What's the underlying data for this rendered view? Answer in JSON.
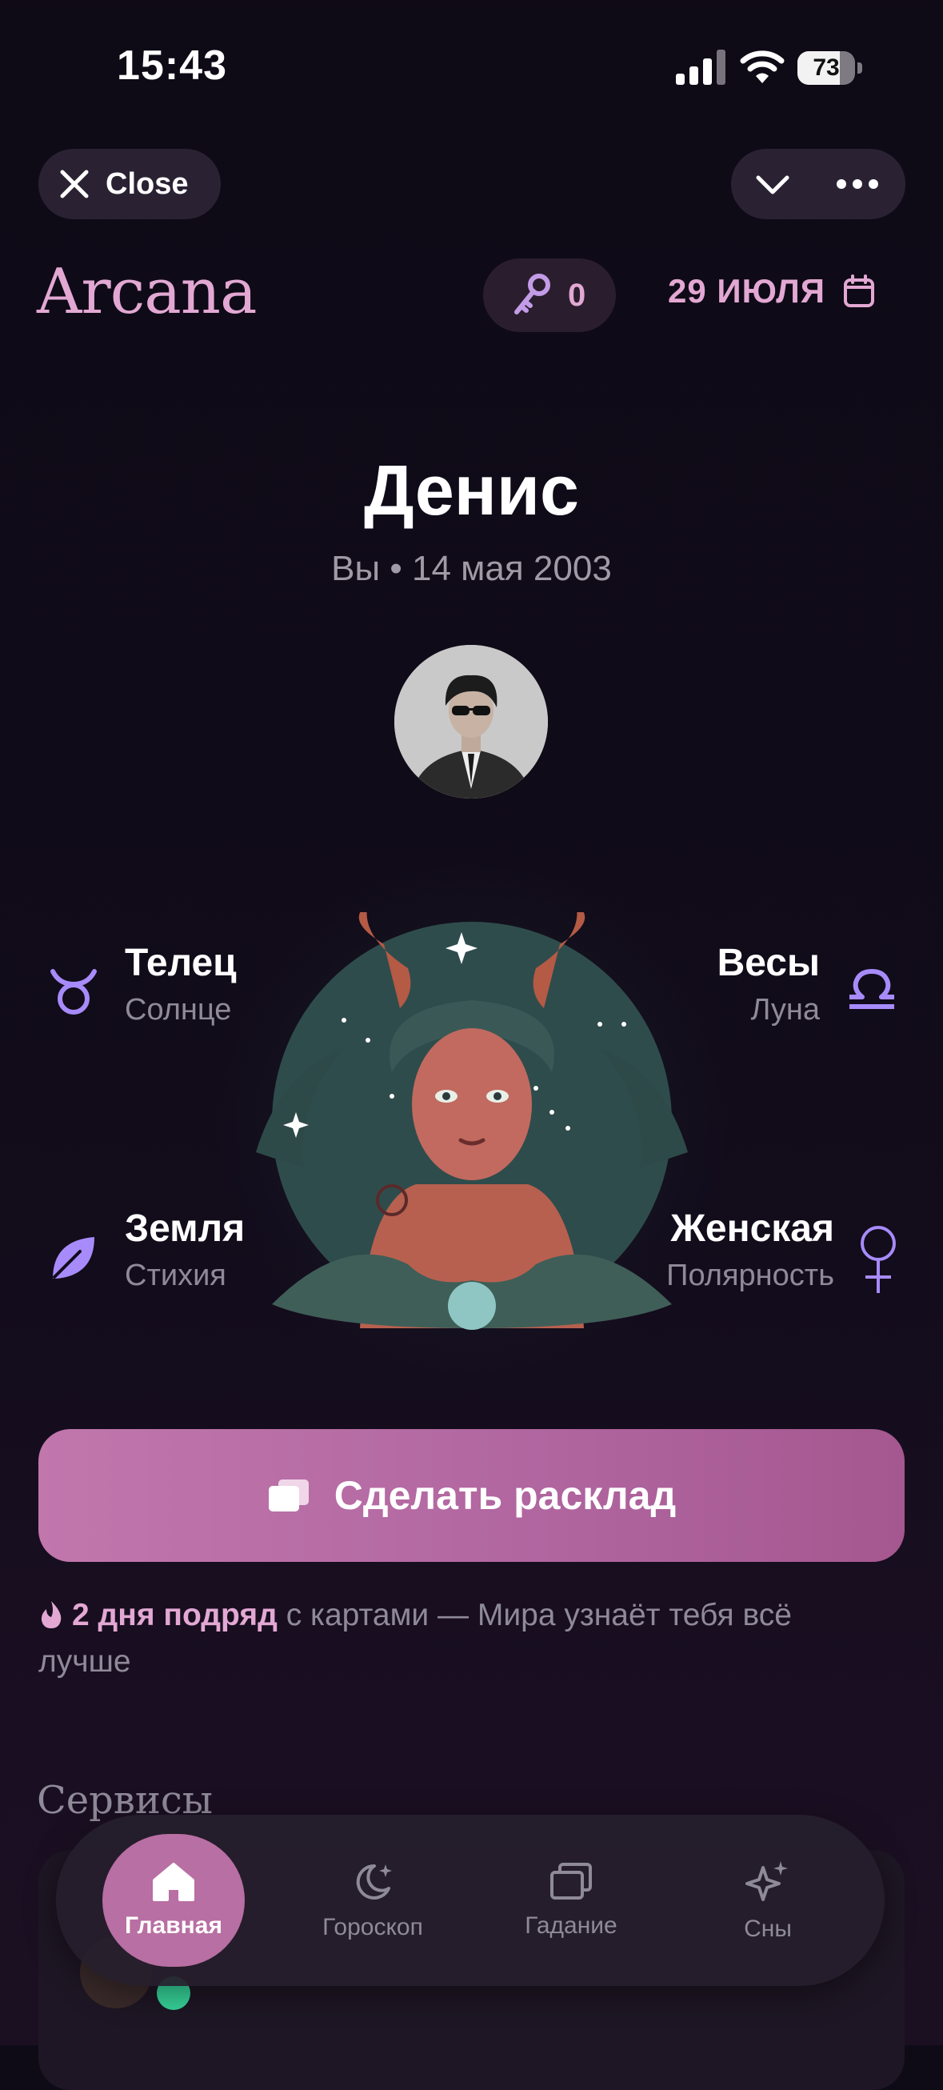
{
  "status_bar": {
    "time": "15:43",
    "battery_percent": "73",
    "battery_level": 0.73
  },
  "top_bar": {
    "close_label": "Close"
  },
  "header": {
    "logo": "Arcana",
    "keys_count": "0",
    "date": "29 ИЮЛЯ"
  },
  "profile": {
    "name": "Денис",
    "subtitle": "Вы • 14 мая 2003"
  },
  "traits": [
    {
      "title": "Телец",
      "sub": "Солнце",
      "icon": "taurus-icon"
    },
    {
      "title": "Весы",
      "sub": "Луна",
      "icon": "libra-icon"
    },
    {
      "title": "Земля",
      "sub": "Стихия",
      "icon": "leaf-icon"
    },
    {
      "title": "Женская",
      "sub": "Полярность",
      "icon": "venus-icon"
    }
  ],
  "cta": {
    "label": "Сделать расклад",
    "icon": "cards-icon"
  },
  "streak": {
    "highlight": "2 дня подряд",
    "rest": " с картами — Мира узнаёт тебя всё лучше",
    "icon": "flame-icon"
  },
  "services": {
    "title": "Сервисы"
  },
  "tabs": [
    {
      "label": "Главная",
      "icon": "home-icon",
      "active": true
    },
    {
      "label": "Гороскоп",
      "icon": "moon-stars-icon",
      "active": false
    },
    {
      "label": "Гадание",
      "icon": "cards-icon",
      "active": false
    },
    {
      "label": "Сны",
      "icon": "sparkles-icon",
      "active": false
    }
  ],
  "colors": {
    "accent": "#e2a8d3",
    "cta": "#b86fa3",
    "trait_icon": "#a78bfa",
    "background": "#0e0a16"
  }
}
